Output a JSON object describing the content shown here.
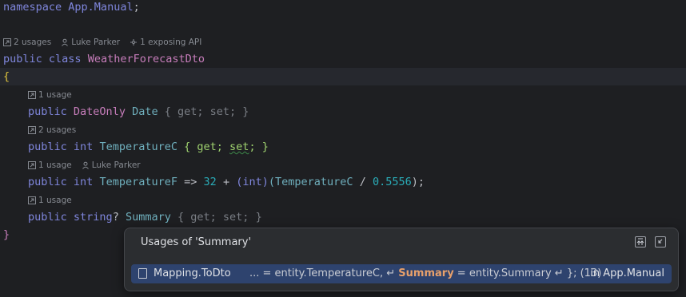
{
  "editor": {
    "ns": {
      "kw": "namespace",
      "name": "App.Manual",
      "semi": ";"
    },
    "class_hints": {
      "usages": "2 usages",
      "author": "Luke Parker",
      "api": "1 exposing API"
    },
    "class_decl": {
      "kw1": "public",
      "kw2": "class",
      "name": "WeatherForecastDto"
    },
    "open_brace": "{",
    "close_brace": "}",
    "members": [
      {
        "hint_usages": "1 usage",
        "access": "public",
        "type": "DateOnly",
        "name": "Date",
        "body": "{ get; set; }"
      },
      {
        "hint_usages": "2 usages",
        "access": "public",
        "type": "int",
        "name": "TemperatureC",
        "body": "{ get; set; }"
      },
      {
        "hint_usages": "1 usage",
        "hint_author": "Luke Parker",
        "access": "public",
        "type": "int",
        "name": "TemperatureF",
        "arrow": "=>",
        "n1": "32",
        "plus": "+",
        "cast": "(int)",
        "ref": "(TemperatureC",
        "div": "/",
        "n2": "0.5556",
        "end": ");"
      },
      {
        "hint_usages": "1 usage",
        "access": "public",
        "type": "string",
        "nullable": "?",
        "name": "Summary",
        "body": "{ get; set; }"
      }
    ]
  },
  "popup": {
    "title": "Usages of 'Summary'",
    "pin_icon": "pin-icon",
    "collapse_icon": "collapse-icon",
    "row": {
      "method": "Mapping.ToDto",
      "ctx_pre": "... = entity.TemperatureC, ↵ ",
      "ctx_hl": "Summary",
      "ctx_post": " = entity.Summary ↵ }; (13)",
      "location": "in App.Manual"
    }
  }
}
